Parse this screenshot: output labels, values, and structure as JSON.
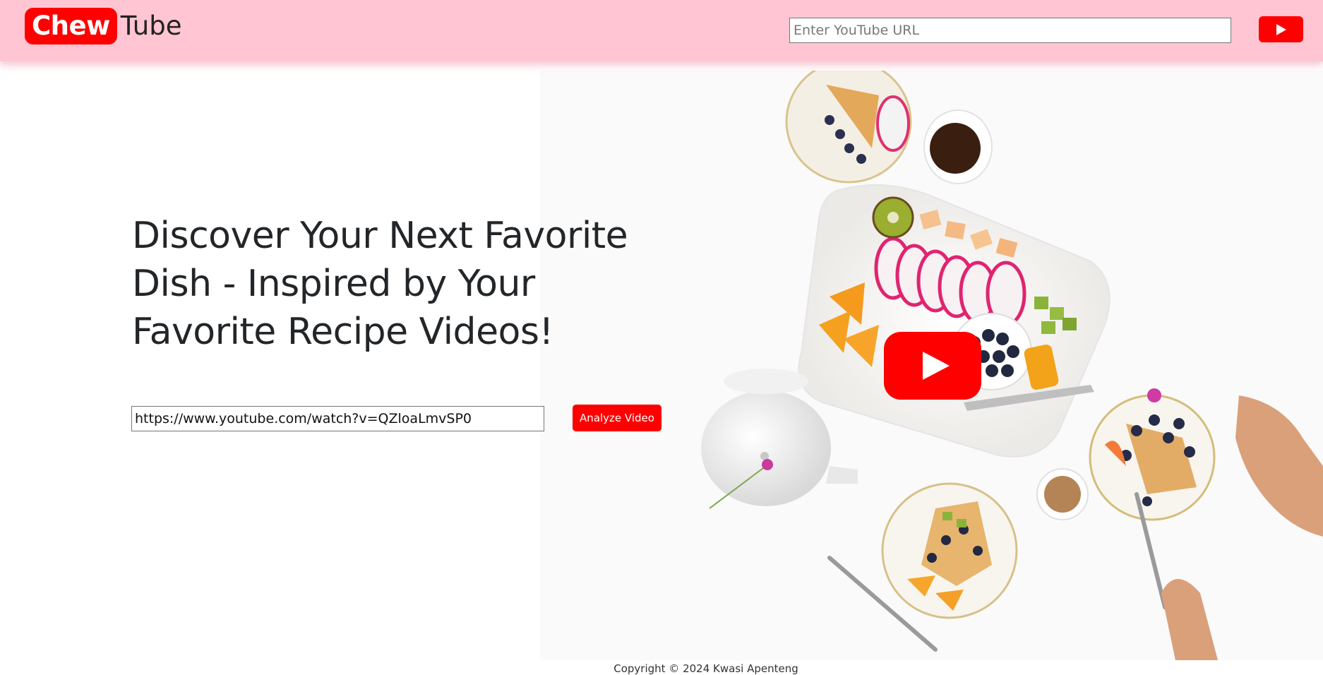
{
  "app": {
    "logo_part1": "Chew",
    "logo_part2": "Tube"
  },
  "nav": {
    "url_placeholder": "Enter YouTube URL",
    "url_value": "",
    "play_icon": "youtube-play-icon"
  },
  "hero": {
    "title": "Discover Your Next Favorite Dish - Inspired by Your Favorite Recipe Videos!",
    "url_value": "https://www.youtube.com/watch?v=QZloaLmvSP0",
    "analyze_label": "Analyze Video",
    "image_icon": "youtube-logo-icon"
  },
  "footer": {
    "copyright": "Copyright © 2024 Kwasi Apenteng"
  },
  "colors": {
    "topbar": "#ffc5d3",
    "accent": "#ff0000",
    "text": "#232629"
  }
}
